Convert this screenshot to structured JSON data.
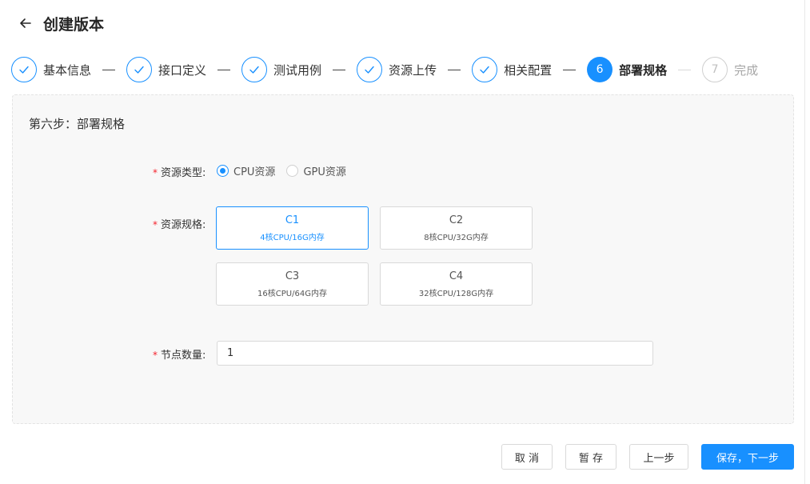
{
  "header": {
    "title": "创建版本"
  },
  "steps": [
    {
      "label": "基本信息",
      "status": "done",
      "number": ""
    },
    {
      "label": "接口定义",
      "status": "done",
      "number": ""
    },
    {
      "label": "测试用例",
      "status": "done",
      "number": ""
    },
    {
      "label": "资源上传",
      "status": "done",
      "number": ""
    },
    {
      "label": "相关配置",
      "status": "done",
      "number": ""
    },
    {
      "label": "部署规格",
      "status": "active",
      "number": "6"
    },
    {
      "label": "完成",
      "status": "todo",
      "number": "7"
    }
  ],
  "form": {
    "section_title": "第六步：部署规格",
    "required_mark": "*",
    "resource_type": {
      "label": "资源类型:",
      "options": [
        "CPU资源",
        "GPU资源"
      ],
      "selected": "CPU资源"
    },
    "resource_spec": {
      "label": "资源规格:",
      "cards": [
        {
          "name": "C1",
          "desc": "4核CPU/16G内存",
          "selected": true
        },
        {
          "name": "C2",
          "desc": "8核CPU/32G内存",
          "selected": false
        },
        {
          "name": "C3",
          "desc": "16核CPU/64G内存",
          "selected": false
        },
        {
          "name": "C4",
          "desc": "32核CPU/128G内存",
          "selected": false
        }
      ]
    },
    "node_count": {
      "label": "节点数量:",
      "value": "1"
    }
  },
  "footer": {
    "cancel": "取 消",
    "save_draft": "暂 存",
    "prev": "上一步",
    "save_next": "保存，下一步"
  },
  "colors": {
    "primary": "#1890ff",
    "required": "#f5222d",
    "panel_bg": "#f8f8f8",
    "border": "#d9d9d9"
  }
}
